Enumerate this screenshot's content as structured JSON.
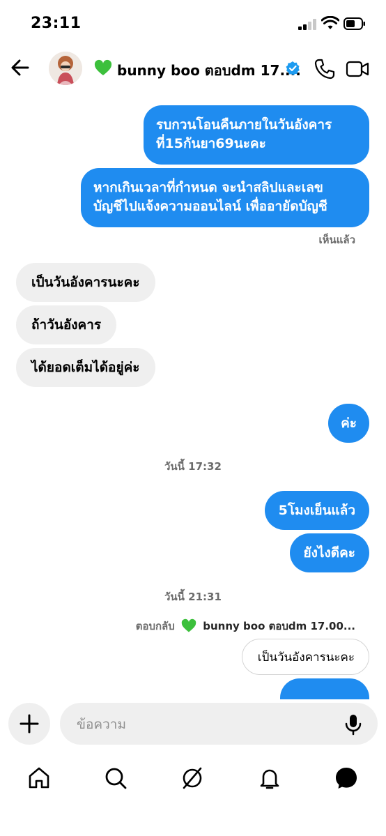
{
  "status_bar": {
    "time": "23:11"
  },
  "header": {
    "contact_name": "bunny boo ตอบdm 17....",
    "heart_icon": "green-heart-icon",
    "verified_icon": "verified-badge-icon"
  },
  "messages": [
    {
      "side": "out",
      "lines": [
        "รบกวนโอนคืนภายในวันอังคาร",
        "ที่15กันยา69นะคะ"
      ]
    },
    {
      "side": "out",
      "lines": [
        "หากเกินเวลาที่กำหนด จะนำสลิปและเลข",
        "บัญชีไปแจ้งความออนไลน์ เพื่ออายัดบัญชี"
      ]
    },
    {
      "side": "in",
      "lines": [
        "เป็นวันอังคารนะคะ"
      ]
    },
    {
      "side": "in",
      "lines": [
        "ถ้าวันอังคาร"
      ]
    },
    {
      "side": "in",
      "lines": [
        "ได้ยอดเต็มได้อยู่ค่ะ"
      ]
    },
    {
      "side": "out",
      "lines": [
        "ค่ะ"
      ]
    },
    {
      "side": "out",
      "lines": [
        "5โมงเย็นแล้ว"
      ]
    },
    {
      "side": "out",
      "lines": [
        "ยังไงดีคะ"
      ]
    }
  ],
  "seen_label": "เห็นแล้ว",
  "timestamps": [
    "วันนี้ 17:32",
    "วันนี้ 21:31"
  ],
  "reply": {
    "prefix": "ตอบกลับ",
    "to_name": "bunny boo ตอบdm 17.00...",
    "quoted": "เป็นวันอังคารนะคะ"
  },
  "composer": {
    "placeholder": "ข้อความ"
  },
  "nav": [
    "home-icon",
    "search-icon",
    "explore-icon",
    "notifications-icon",
    "messenger-icon"
  ],
  "colors": {
    "accent": "#1f8cf0",
    "incoming_bubble": "#efefef",
    "verified": "#1d9bf0",
    "heart": "#3cc03c"
  }
}
